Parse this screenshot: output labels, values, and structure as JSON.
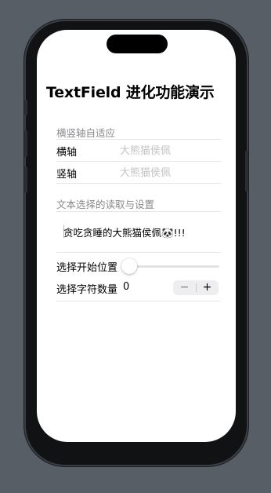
{
  "title": "TextField 进化功能演示",
  "axis_section": {
    "header": "横竖轴自适应",
    "rows": [
      {
        "label": "横轴",
        "placeholder": "大熊猫侯佩"
      },
      {
        "label": "竖轴",
        "placeholder": "大熊猫侯佩"
      }
    ]
  },
  "selection_section": {
    "header": "文本选择的读取与设置",
    "text_value": "贪吃贪睡的大熊猫侯佩🐼!!!",
    "start_label": "选择开始位置",
    "start_position": 0,
    "count_label": "选择字符数量",
    "count_value": "0",
    "minus_label": "−",
    "plus_label": "+"
  }
}
